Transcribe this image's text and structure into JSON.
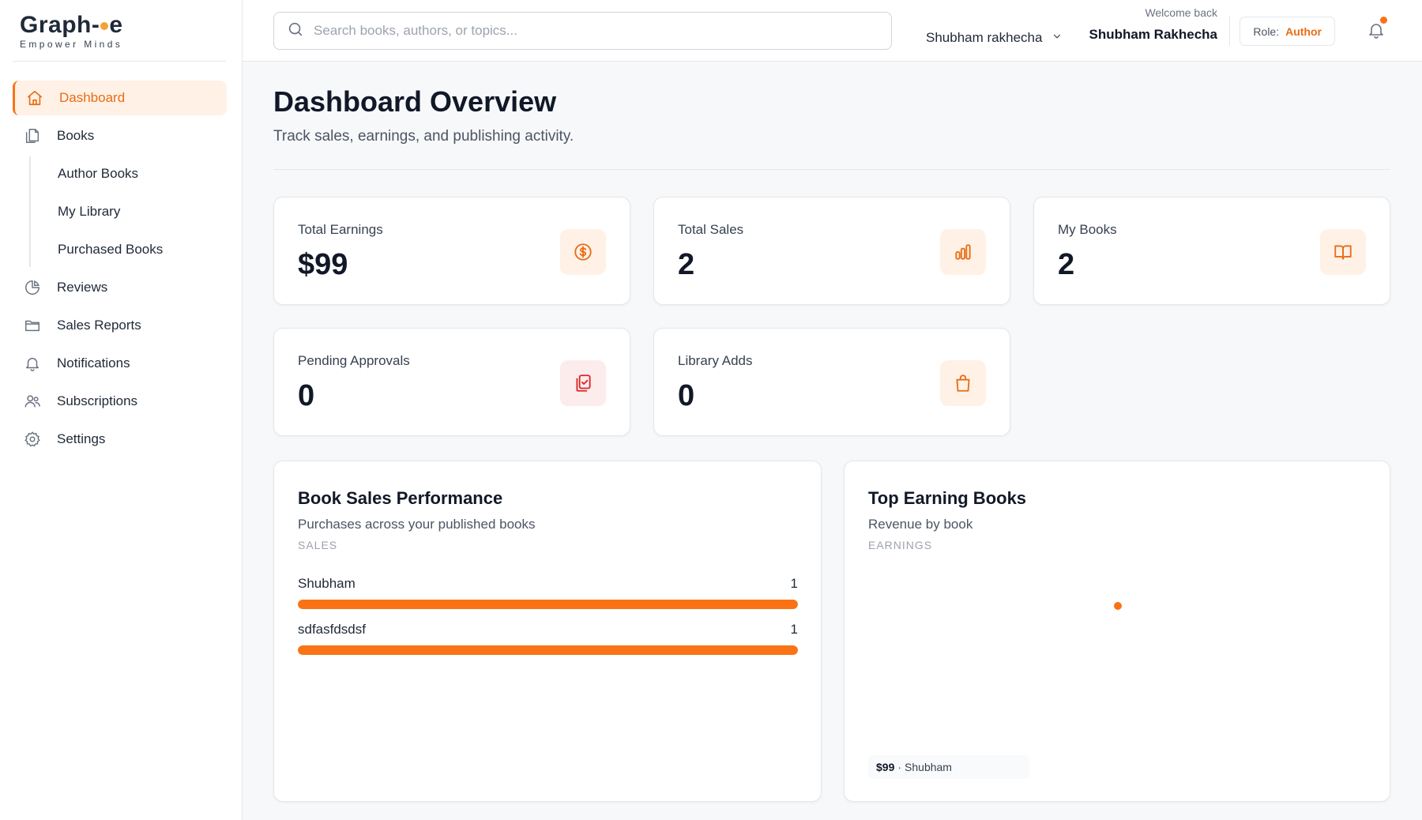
{
  "brand": {
    "name_left": "Graph",
    "name_right": "e",
    "tagline": "Empower Minds"
  },
  "sidebar": {
    "items": [
      {
        "label": "Dashboard",
        "icon": "home-icon",
        "active": true
      },
      {
        "label": "Books",
        "icon": "copy-icon"
      },
      {
        "label": "Author Books",
        "sub": true
      },
      {
        "label": "My Library",
        "sub": true
      },
      {
        "label": "Purchased Books",
        "sub": true
      },
      {
        "label": "Reviews",
        "icon": "pie-chart-icon"
      },
      {
        "label": "Sales Reports",
        "icon": "folder-icon"
      },
      {
        "label": "Notifications",
        "icon": "bell-icon"
      },
      {
        "label": "Subscriptions",
        "icon": "users-icon"
      },
      {
        "label": "Settings",
        "icon": "gear-icon"
      }
    ]
  },
  "header": {
    "search_placeholder": "Search books, authors, or topics...",
    "user_select": "Shubham rakhecha",
    "welcome_label": "Welcome back",
    "welcome_name": "Shubham Rakhecha",
    "role_label": "Role:",
    "role_value": "Author",
    "has_unread": true
  },
  "page": {
    "title": "Dashboard Overview",
    "subtitle": "Track sales, earnings, and publishing activity."
  },
  "stats": [
    {
      "label": "Total Earnings",
      "value": "$99",
      "icon": "dollar-circle-icon"
    },
    {
      "label": "Total Sales",
      "value": "2",
      "icon": "bar-chart-icon"
    },
    {
      "label": "My Books",
      "value": "2",
      "icon": "open-book-icon"
    },
    {
      "label": "Pending Approvals",
      "value": "0",
      "icon": "clipboard-check-icon"
    },
    {
      "label": "Library Adds",
      "value": "0",
      "icon": "shopping-bag-icon"
    }
  ],
  "sales_panel": {
    "title": "Book Sales Performance",
    "subtitle": "Purchases across your published books",
    "caption": "SALES"
  },
  "earnings_panel": {
    "title": "Top Earning Books",
    "subtitle": "Revenue by book",
    "caption": "EARNINGS",
    "legend_amount": "$99",
    "legend_sep": "·",
    "legend_book": "Shubham"
  },
  "chart_data": [
    {
      "type": "bar",
      "orientation": "horizontal",
      "categories": [
        "Shubham",
        "sdfasfdsdsf"
      ],
      "values": [
        1,
        1
      ],
      "xlim": [
        0,
        1
      ],
      "color": "#f97316"
    },
    {
      "type": "pie",
      "categories": [
        "Shubham"
      ],
      "values": [
        99
      ],
      "color": "#f97316"
    }
  ],
  "colors": {
    "accent": "#f97316",
    "accent_bg": "#fff1e6"
  }
}
